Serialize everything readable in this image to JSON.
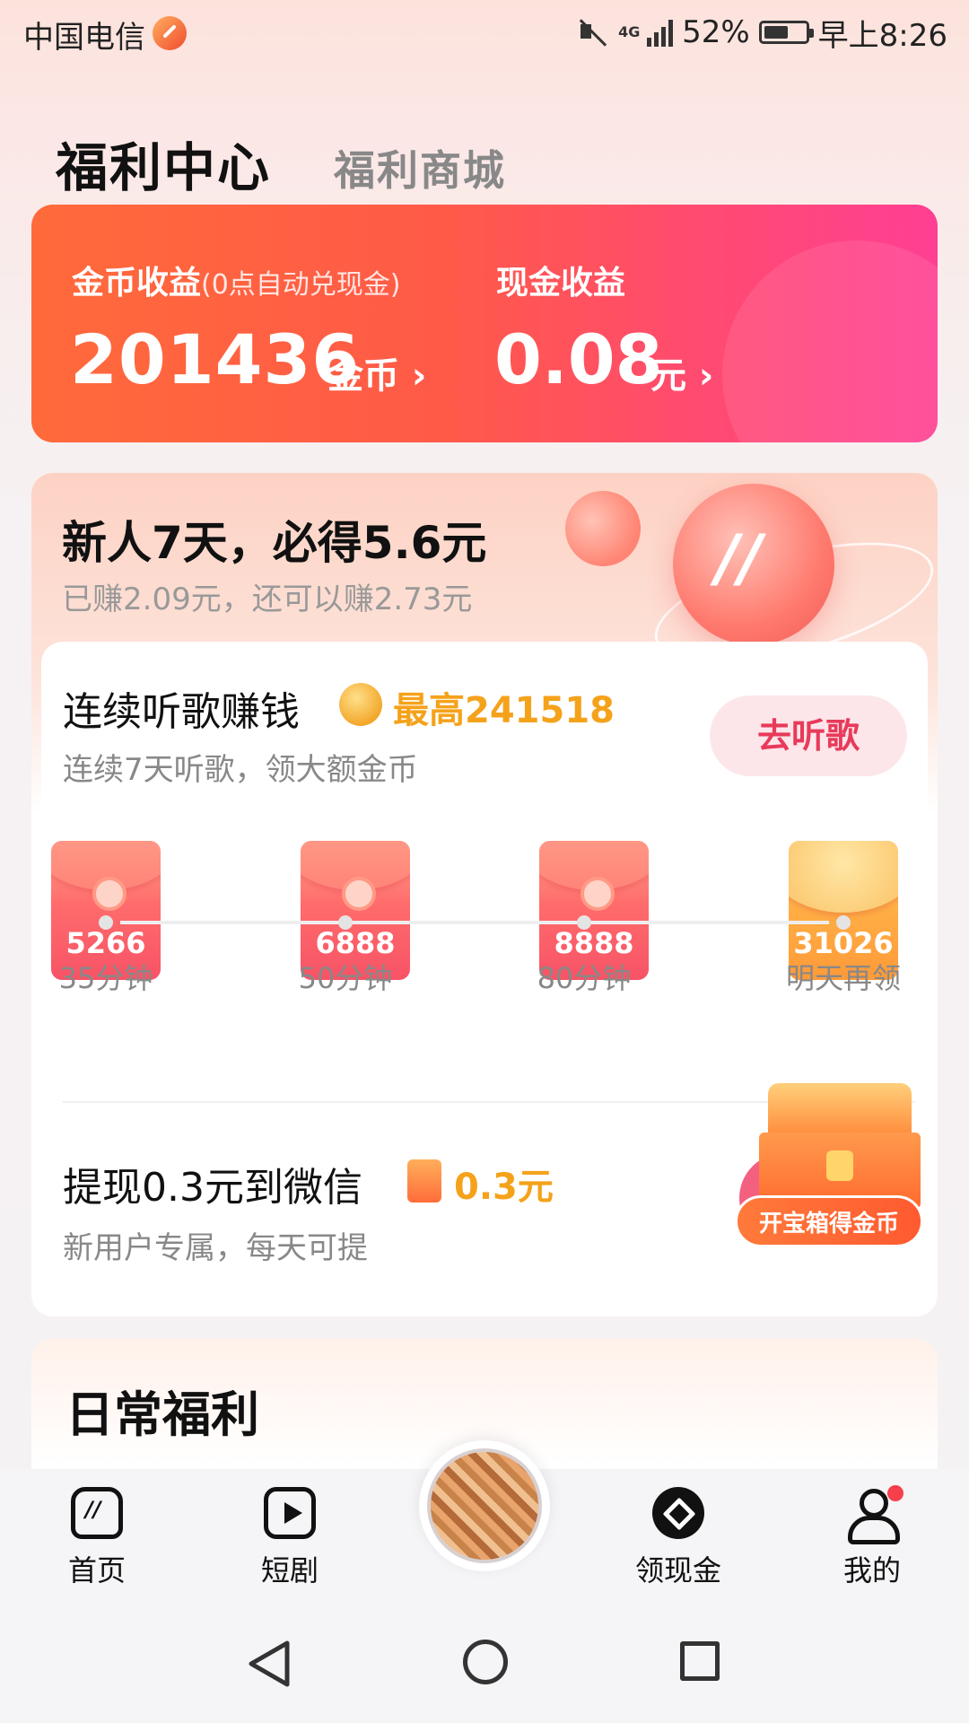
{
  "status_bar": {
    "carrier": "中国电信",
    "network": "4G",
    "battery": "52%",
    "time": "早上8:26"
  },
  "tabs": {
    "active": "福利中心",
    "inactive": "福利商城"
  },
  "earnings": {
    "coin_label": "金币收益",
    "coin_note": "(0点自动兑现金)",
    "coin_value": "201436",
    "coin_unit": "金币 ›",
    "cash_label": "现金收益",
    "cash_value": "0.08",
    "cash_unit": "元 ›"
  },
  "newbie": {
    "title": "新人7天，必得5.6元",
    "subtitle": "已赚2.09元，还可以赚2.73元"
  },
  "listen": {
    "title": "连续听歌赚钱",
    "max": "最高241518",
    "subtitle": "连续7天听歌，领大额金币",
    "button": "去听歌",
    "rewards": [
      {
        "value": "5266",
        "time": "35分钟"
      },
      {
        "value": "6888",
        "time": "50分钟"
      },
      {
        "value": "8888",
        "time": "80分钟"
      },
      {
        "value": "31026",
        "time": "明天再领"
      }
    ]
  },
  "withdraw": {
    "title": "提现0.3元到微信",
    "amount": "0.3元",
    "subtitle": "新用户专属，每天可提",
    "chest_button": "开宝箱得金币"
  },
  "daily": {
    "title": "日常福利"
  },
  "bottom_nav": {
    "items": [
      {
        "label": "首页",
        "icon": "home-icon"
      },
      {
        "label": "短剧",
        "icon": "play-icon"
      },
      {
        "label": "",
        "icon": "music-disc"
      },
      {
        "label": "领现金",
        "icon": "cash-icon"
      },
      {
        "label": "我的",
        "icon": "user-icon"
      }
    ]
  },
  "colors": {
    "accent_orange": "#ff6a3a",
    "accent_pink": "#ff3f93",
    "gold_text": "#f5a21b",
    "button_text": "#e83a5a"
  }
}
